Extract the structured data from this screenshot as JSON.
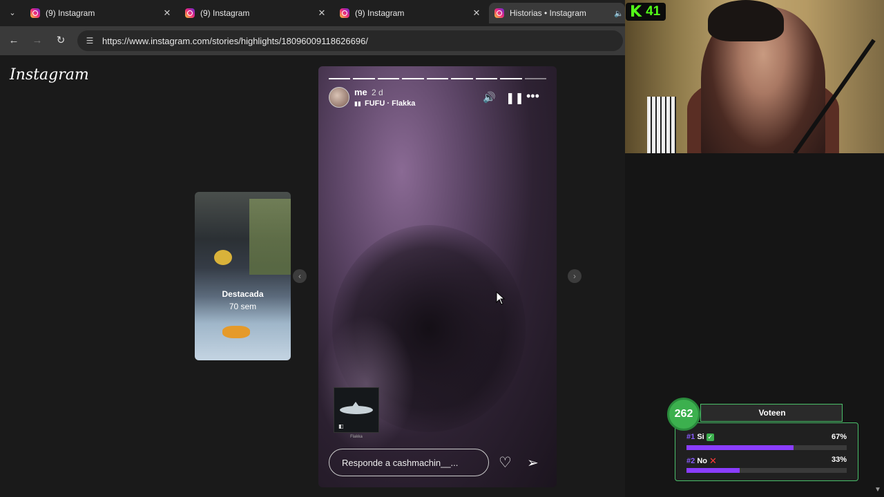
{
  "browser": {
    "tabs": [
      {
        "title": "(9) Instagram",
        "active": false
      },
      {
        "title": "(9) Instagram",
        "active": false
      },
      {
        "title": "(9) Instagram",
        "active": false
      },
      {
        "title": "Historias • Instagram",
        "active": true
      }
    ],
    "close_glyph": "✕",
    "url": "https://www.instagram.com/stories/highlights/18096009118626696/"
  },
  "instagram": {
    "logo": "Instagram",
    "previous": {
      "label": "Destacada",
      "sublabel": "70 sem"
    },
    "story": {
      "username": "me",
      "time": "2 d",
      "song": "FUFU · Flakka",
      "progress_total": 9,
      "progress_done": 8,
      "sticker_caption": "Flakka",
      "reply_placeholder": "Responde a cashmachin__..."
    }
  },
  "stream": {
    "kick_viewers": "41",
    "poll": {
      "count": "262",
      "title": "Voteen",
      "options": [
        {
          "rank": "#1",
          "label": "Si",
          "pct": "67%",
          "value": 0.67
        },
        {
          "rank": "#2",
          "label": "No",
          "pct": "33%",
          "value": 0.33
        }
      ]
    }
  },
  "colors": {
    "poll_bar": "#8a3dff",
    "poll_border": "#4ac06a",
    "kick": "#53fc18"
  }
}
